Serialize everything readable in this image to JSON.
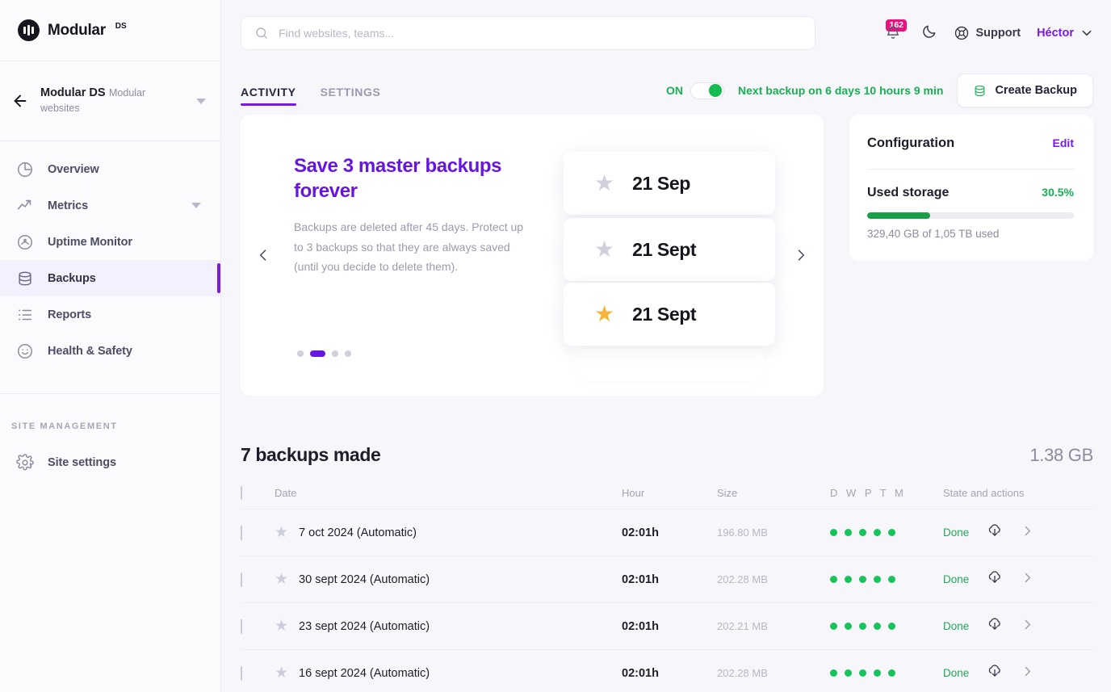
{
  "brand": {
    "name": "Modular",
    "sup": "DS"
  },
  "workspace": {
    "title": "Modular DS",
    "subtitle": "Modular websites"
  },
  "sidebar": {
    "items": [
      {
        "label": "Overview",
        "icon": "pie-chart-icon"
      },
      {
        "label": "Metrics",
        "icon": "trending-up-icon"
      },
      {
        "label": "Uptime Monitor",
        "icon": "gauge-icon"
      },
      {
        "label": "Backups",
        "icon": "database-icon"
      },
      {
        "label": "Reports",
        "icon": "list-icon"
      },
      {
        "label": "Health & Safety",
        "icon": "smiley-icon"
      }
    ],
    "section_label": "SITE MANAGEMENT",
    "site_settings": {
      "label": "Site settings",
      "icon": "gear-icon"
    }
  },
  "topbar": {
    "search_placeholder": "Find websites, teams...",
    "search_value": "",
    "notifications_count": "162",
    "support_label": "Support",
    "user_name": "Héctor"
  },
  "tabs": [
    {
      "label": "ACTIVITY",
      "active": true
    },
    {
      "label": "SETTINGS",
      "active": false
    }
  ],
  "backup_control": {
    "toggle_label": "ON",
    "toggle_state": "on",
    "next_backup": "Next backup on 6 days 10 hours 9 min",
    "create_button": "Create Backup"
  },
  "promo": {
    "title": "Save 3 master backups forever",
    "body": "Backups are deleted after 45 days. Protect up to 3 backups so that they are always saved (until you decide to delete them).",
    "dots_count": 4,
    "active_dot": 1,
    "art_cards": [
      {
        "date": "21 Sep",
        "starred": false
      },
      {
        "date": "21 Sept",
        "starred": false
      },
      {
        "date": "21 Sept",
        "starred": true
      }
    ]
  },
  "configuration": {
    "title": "Configuration",
    "edit_label": "Edit",
    "storage_label": "Used storage",
    "storage_percent": "30.5%",
    "storage_percent_value": 30.5,
    "storage_detail": "329,40 GB of 1,05 TB used",
    "accent_green": "#1a9e46"
  },
  "backups": {
    "title": "7 backups made",
    "total_size": "1.38 GB",
    "columns": {
      "date": "Date",
      "hour": "Hour",
      "size": "Size",
      "flags": "D W P T M",
      "state": "State and actions"
    },
    "rows": [
      {
        "date": "7 oct 2024 (Automatic)",
        "hour": "02:01h",
        "size": "196.80 MB",
        "flags": 5,
        "state": "Done",
        "starred": false
      },
      {
        "date": "30 sept 2024 (Automatic)",
        "hour": "02:01h",
        "size": "202.28 MB",
        "flags": 5,
        "state": "Done",
        "starred": false
      },
      {
        "date": "23 sept 2024 (Automatic)",
        "hour": "02:01h",
        "size": "202.21 MB",
        "flags": 5,
        "state": "Done",
        "starred": false
      },
      {
        "date": "16 sept 2024 (Automatic)",
        "hour": "02:01h",
        "size": "202.28 MB",
        "flags": 5,
        "state": "Done",
        "starred": false
      }
    ]
  },
  "colors": {
    "accent": "#7b18e8",
    "green": "#17b153",
    "badge": "#e8117f",
    "star": "#f5b53d"
  }
}
